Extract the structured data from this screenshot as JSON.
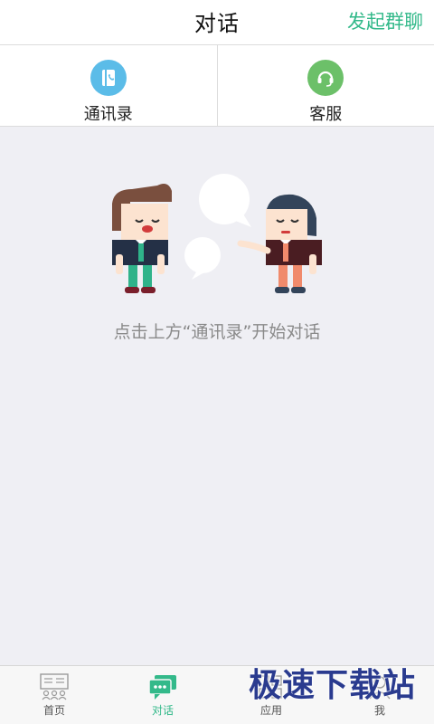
{
  "header": {
    "title": "对话",
    "action_label": "发起群聊"
  },
  "entries": [
    {
      "label": "通讯录",
      "icon": "contacts-book-icon",
      "color": "#5bbce8"
    },
    {
      "label": "客服",
      "icon": "headset-icon",
      "color": "#6cc069"
    }
  ],
  "empty_state": {
    "hint": "点击上方“通讯录”开始对话"
  },
  "tabs": [
    {
      "label": "首页",
      "icon": "home-news-icon",
      "active": false
    },
    {
      "label": "对话",
      "icon": "chat-icon",
      "active": true
    },
    {
      "label": "应用",
      "icon": "apps-icon",
      "active": false
    },
    {
      "label": "我",
      "icon": "me-icon",
      "active": false
    }
  ],
  "watermark": "极速下载站",
  "colors": {
    "accent": "#33b98a",
    "background": "#efeff4"
  }
}
